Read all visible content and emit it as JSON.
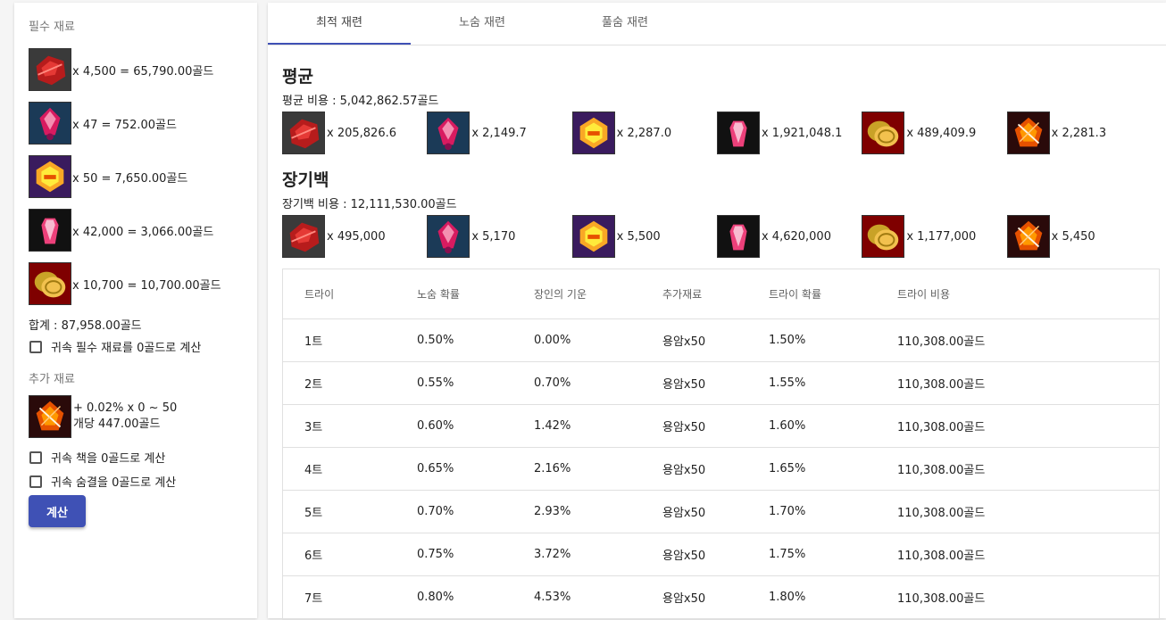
{
  "colors": {
    "accent": "#3f51b5"
  },
  "left": {
    "required_title": "필수 재료",
    "materials": [
      {
        "icon": "red-stone-icon",
        "text": "x 4,500 = 65,790.00골드"
      },
      {
        "icon": "pink-crystal-icon",
        "text": "x 47 = 752.00골드"
      },
      {
        "icon": "gold-ore-icon",
        "text": "x 50 = 7,650.00골드"
      },
      {
        "icon": "ruby-shard-icon",
        "text": "x 42,000 = 3,066.00골드"
      },
      {
        "icon": "gold-coin-icon",
        "text": "x 10,700 = 10,700.00골드"
      }
    ],
    "total": "합계 : 87,958.00골드",
    "check_bound_required": "귀속 필수 재료를 0골드로 계산",
    "extra_title": "추가 재료",
    "extra": {
      "icon": "fire-gem-icon",
      "line1": "+ 0.02% x 0 ~ 50",
      "line2": "개당 447.00골드"
    },
    "check_bound_book": "귀속 책을 0골드로 계산",
    "check_bound_breath": "귀속 숨결을 0골드로 계산",
    "calc_button": "계산"
  },
  "tabs": [
    {
      "label": "최적 재련",
      "active": true
    },
    {
      "label": "노숨 재련",
      "active": false
    },
    {
      "label": "풀숨 재련",
      "active": false
    }
  ],
  "average": {
    "title": "평균",
    "cost": "평균 비용 : 5,042,862.57골드",
    "items": [
      {
        "icon": "red-stone-icon",
        "text": "x 205,826.6"
      },
      {
        "icon": "pink-crystal-icon",
        "text": "x 2,149.7"
      },
      {
        "icon": "gold-ore-icon",
        "text": "x 2,287.0"
      },
      {
        "icon": "ruby-shard-icon",
        "text": "x 1,921,048.1"
      },
      {
        "icon": "gold-coin-icon",
        "text": "x 489,409.9"
      },
      {
        "icon": "fire-gem-icon",
        "text": "x 2,281.3"
      }
    ]
  },
  "jangi": {
    "title": "장기백",
    "cost": "장기백 비용 : 12,111,530.00골드",
    "items": [
      {
        "icon": "red-stone-icon",
        "text": "x 495,000"
      },
      {
        "icon": "pink-crystal-icon",
        "text": "x 5,170"
      },
      {
        "icon": "gold-ore-icon",
        "text": "x 5,500"
      },
      {
        "icon": "ruby-shard-icon",
        "text": "x 4,620,000"
      },
      {
        "icon": "gold-coin-icon",
        "text": "x 1,177,000"
      },
      {
        "icon": "fire-gem-icon",
        "text": "x 5,450"
      }
    ]
  },
  "table": {
    "headers": [
      "트라이",
      "노숨 확률",
      "장인의 기운",
      "추가재료",
      "트라이 확률",
      "트라이 비용"
    ],
    "rows": [
      [
        "1트",
        "0.50%",
        "0.00%",
        "용암x50",
        "1.50%",
        "110,308.00골드"
      ],
      [
        "2트",
        "0.55%",
        "0.70%",
        "용암x50",
        "1.55%",
        "110,308.00골드"
      ],
      [
        "3트",
        "0.60%",
        "1.42%",
        "용암x50",
        "1.60%",
        "110,308.00골드"
      ],
      [
        "4트",
        "0.65%",
        "2.16%",
        "용암x50",
        "1.65%",
        "110,308.00골드"
      ],
      [
        "5트",
        "0.70%",
        "2.93%",
        "용암x50",
        "1.70%",
        "110,308.00골드"
      ],
      [
        "6트",
        "0.75%",
        "3.72%",
        "용암x50",
        "1.75%",
        "110,308.00골드"
      ],
      [
        "7트",
        "0.80%",
        "4.53%",
        "용암x50",
        "1.80%",
        "110,308.00골드"
      ]
    ]
  }
}
